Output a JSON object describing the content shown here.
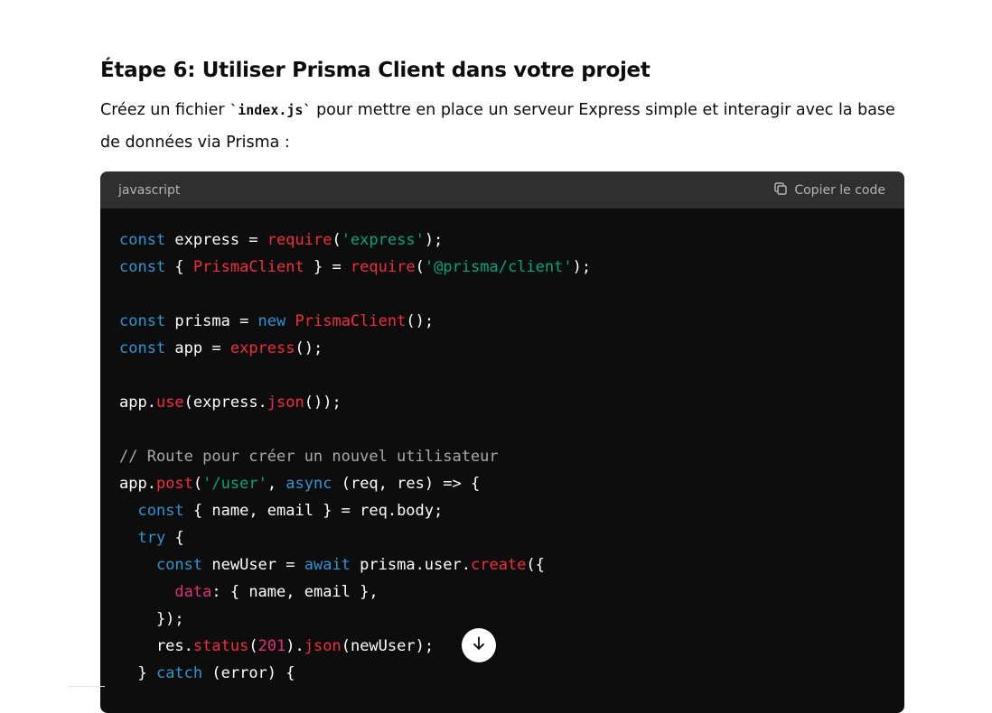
{
  "heading": "Étape 6: Utiliser Prisma Client dans votre projet",
  "description": {
    "before": "Créez un fichier ",
    "code": "`index.js`",
    "after": " pour mettre en place un serveur Express simple et interagir avec la base de données via Prisma :"
  },
  "codeblock": {
    "language": "javascript",
    "copy_label": "Copier le code",
    "copy_icon": "copy-icon",
    "lines": [
      [
        [
          "kw",
          "const"
        ],
        [
          "p",
          " express = "
        ],
        [
          "fnc",
          "require"
        ],
        [
          "p",
          "("
        ],
        [
          "str",
          "'express'"
        ],
        [
          "p",
          ");"
        ]
      ],
      [
        [
          "kw",
          "const"
        ],
        [
          "p",
          " { "
        ],
        [
          "cls",
          "PrismaClient"
        ],
        [
          "p",
          " } = "
        ],
        [
          "fnc",
          "require"
        ],
        [
          "p",
          "("
        ],
        [
          "str",
          "'@prisma/client'"
        ],
        [
          "p",
          ");"
        ]
      ],
      [],
      [
        [
          "kw",
          "const"
        ],
        [
          "p",
          " prisma = "
        ],
        [
          "kw",
          "new"
        ],
        [
          "p",
          " "
        ],
        [
          "cls",
          "PrismaClient"
        ],
        [
          "p",
          "();"
        ]
      ],
      [
        [
          "kw",
          "const"
        ],
        [
          "p",
          " app = "
        ],
        [
          "fnc",
          "express"
        ],
        [
          "p",
          "();"
        ]
      ],
      [],
      [
        [
          "p",
          "app."
        ],
        [
          "fnc",
          "use"
        ],
        [
          "p",
          "(express."
        ],
        [
          "fnc",
          "json"
        ],
        [
          "p",
          "());"
        ]
      ],
      [],
      [
        [
          "cm",
          "// Route pour créer un nouvel utilisateur"
        ]
      ],
      [
        [
          "p",
          "app."
        ],
        [
          "fnc",
          "post"
        ],
        [
          "p",
          "("
        ],
        [
          "str",
          "'/user'"
        ],
        [
          "p",
          ", "
        ],
        [
          "kw",
          "async"
        ],
        [
          "p",
          " (req, res) => {"
        ]
      ],
      [
        [
          "p",
          "  "
        ],
        [
          "kw",
          "const"
        ],
        [
          "p",
          " { name, email } = req.body;"
        ]
      ],
      [
        [
          "p",
          "  "
        ],
        [
          "kw",
          "try"
        ],
        [
          "p",
          " {"
        ]
      ],
      [
        [
          "p",
          "    "
        ],
        [
          "kw",
          "const"
        ],
        [
          "p",
          " newUser = "
        ],
        [
          "kw",
          "await"
        ],
        [
          "p",
          " prisma.user."
        ],
        [
          "fnc",
          "create"
        ],
        [
          "p",
          "({"
        ]
      ],
      [
        [
          "p",
          "      "
        ],
        [
          "fn",
          "data"
        ],
        [
          "p",
          ": { name, email },"
        ]
      ],
      [
        [
          "p",
          "    });"
        ]
      ],
      [
        [
          "p",
          "    res."
        ],
        [
          "fnc",
          "status"
        ],
        [
          "p",
          "("
        ],
        [
          "num",
          "201"
        ],
        [
          "p",
          ")."
        ],
        [
          "fnc",
          "json"
        ],
        [
          "p",
          "(newUser);"
        ]
      ],
      [
        [
          "p",
          "  } "
        ],
        [
          "kw",
          "catch"
        ],
        [
          "p",
          " (error) {"
        ]
      ]
    ]
  },
  "scroll_button_icon": "arrow-down-icon"
}
